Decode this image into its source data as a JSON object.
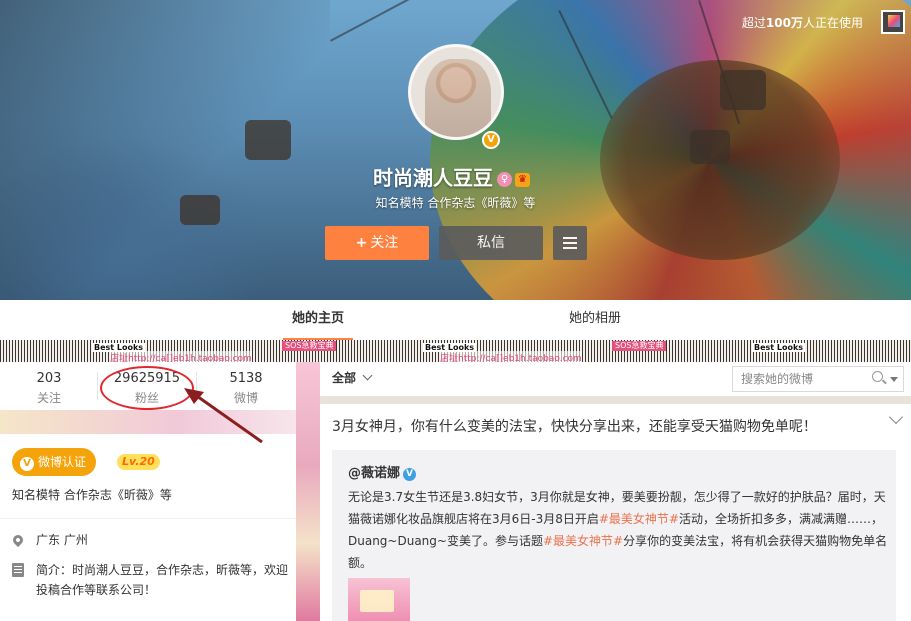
{
  "cover": {
    "notice_prefix": "超过",
    "notice_count": "100万",
    "notice_suffix": "人正在使用",
    "name": "时尚潮人豆豆",
    "verify_mark": "V",
    "intro": "知名模特 合作杂志《昕薇》等",
    "follow_plus": "+",
    "follow_label": "关注",
    "message_label": "私信"
  },
  "tabs": {
    "home": "她的主页",
    "album": "她的相册"
  },
  "strip": {
    "label": "Best Looks",
    "url": "店址http://ca[]eb1h.taobao.com",
    "pink": "SOS急救宝典"
  },
  "stats": [
    {
      "value": "203",
      "label": "关注"
    },
    {
      "value": "29625915",
      "label": "粉丝"
    },
    {
      "value": "5138",
      "label": "微博"
    }
  ],
  "profile": {
    "verify_mark": "V",
    "verify_label": "微博认证",
    "level": "Lv.20",
    "intro": "知名模特 合作杂志《昕薇》等",
    "location": "广东 广州",
    "bio": "简介：时尚潮人豆豆，合作杂志，昕薇等，欢迎投稿合作等联系公司！"
  },
  "feed": {
    "filter_label": "全部",
    "search_placeholder": "搜索她的微博",
    "post_text": "3月女神月，你有什么变美的法宝，快快分享出来，还能享受天猫购物免单呢！",
    "quote_author": "@薇诺娜",
    "quote_verify_mark": "V",
    "quote_part1": "无论是3.7女生节还是3.8妇女节，3月你就是女神，要美要扮靓，怎少得了一款好的护肤品？届时，天猫薇诺娜化妆品旗舰店将在3月6日-3月8日开启",
    "quote_topic1": "#最美女神节#",
    "quote_part2": "活动，全场折扣多多，满减满赠……，Duang~Duang~变美了。参与话题",
    "quote_topic2": "#最美女神节#",
    "quote_part3": "分享你的变美法宝，将有机会获得天猫购物免单名额。"
  },
  "colors": {
    "accent": "#ff8140",
    "verify": "#f5a30a",
    "topic": "#eb7350",
    "annotation": "#e0282e"
  }
}
